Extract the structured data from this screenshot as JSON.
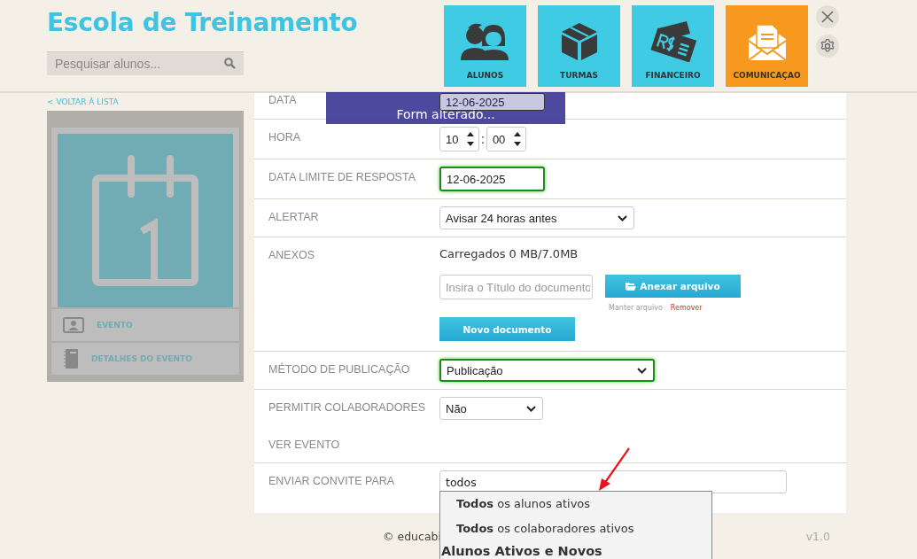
{
  "header": {
    "title": "Escola de Treinamento",
    "search": {
      "placeholder": "Pesquisar alunos..."
    },
    "nav": [
      {
        "label": "ALUNOS",
        "selected": false
      },
      {
        "label": "TURMAS",
        "selected": false
      },
      {
        "label": "FINANCEIRO",
        "selected": false
      },
      {
        "label": "COMUNICAÇAO",
        "selected": true
      }
    ]
  },
  "sidebar": {
    "back_link": "< VOLTAR À LISTA",
    "menu": [
      {
        "label": "EVENTO"
      },
      {
        "label": "DETALHES DO EVENTO"
      }
    ]
  },
  "toast": "Form alterado...",
  "form": {
    "rows": [
      {
        "kind": "date",
        "label": "DATA",
        "value": "12-06-2025",
        "focused": false
      },
      {
        "kind": "time",
        "label": "HORA",
        "hour": "10",
        "separator": ":",
        "minute": "00"
      },
      {
        "kind": "date",
        "label": "DATA LIMITE DE RESPOSTA",
        "value": "12-06-2025",
        "focused": true
      },
      {
        "kind": "select",
        "label": "ALERTAR",
        "value": "Avisar 24 horas antes",
        "focused": false
      },
      {
        "kind": "attachments",
        "label": "ANEXOS",
        "usage": "Carregados 0 MB/7.0MB",
        "title_placeholder": "Insira o Título do documento",
        "attach_button": "Anexar arquivo",
        "keep_link": "Manter arquivo",
        "remove_link": "Remover",
        "new_button": "Novo documento"
      },
      {
        "kind": "select",
        "label": "MÉTODO DE PUBLICAÇÃO",
        "value": "Publicação",
        "focused": true
      },
      {
        "kind": "select",
        "label": "PERMITIR COLABORADORES",
        "value": "Não",
        "focused": false
      },
      {
        "kind": "label",
        "label": "VER EVENTO"
      },
      {
        "kind": "autocomplete",
        "label": "ENVIAR CONVITE PARA",
        "value": "todos",
        "suggestions": [
          "**Todos** os alunos ativos",
          "**Todos** os colaboradores ativos"
        ],
        "group_header": "Alunos Ativos e Novos"
      }
    ]
  },
  "footer": {
    "copyright": "© educabi",
    "version": "v1.0"
  }
}
